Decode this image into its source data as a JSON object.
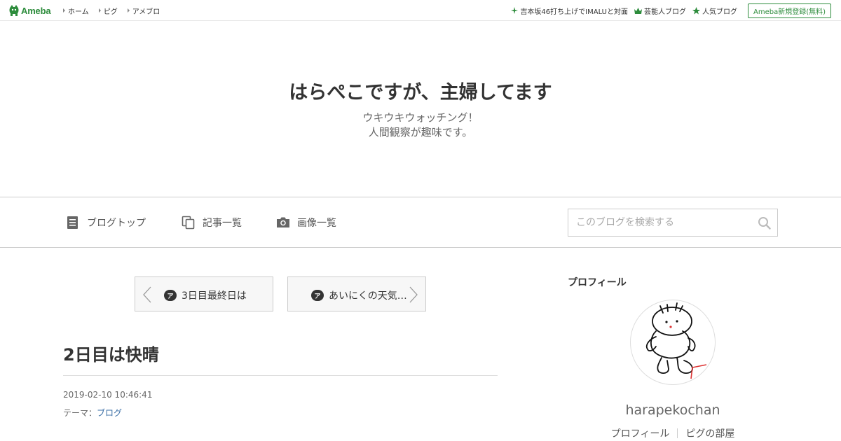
{
  "topbar": {
    "logo_text": "Ameba",
    "nav": [
      {
        "label": "ホーム"
      },
      {
        "label": "ピグ"
      },
      {
        "label": "アメブロ"
      }
    ],
    "right": [
      {
        "label": "吉本坂46打ち上げでIMALUと対面",
        "icon": "sparkle-icon"
      },
      {
        "label": "芸能人ブログ",
        "icon": "crown-icon"
      },
      {
        "label": "人気ブログ",
        "icon": "star-icon"
      }
    ],
    "signup_label": "Ameba新規登録(無料)",
    "accent": "#2d8c3c"
  },
  "header": {
    "title": "はらぺこですが、主婦してます",
    "desc_line1": "ウキウキウォッチング！",
    "desc_line2": "人間観察が趣味です。"
  },
  "subnav": {
    "items": [
      {
        "label": "ブログトップ",
        "icon": "document-icon"
      },
      {
        "label": "記事一覧",
        "icon": "copy-icon"
      },
      {
        "label": "画像一覧",
        "icon": "camera-icon"
      }
    ],
    "search_placeholder": "このブログを検索する"
  },
  "pager": {
    "prev_label": "3日目最終日は",
    "next_label": "あいにくの天気…",
    "badge": "ア"
  },
  "article": {
    "title": "2日目は快晴",
    "date": "2019-02-10 10:46:41",
    "theme_prefix": "テーマ：",
    "theme_link": "ブログ"
  },
  "sidebar": {
    "heading": "プロフィール",
    "username": "harapekochan",
    "links": [
      {
        "label": "プロフィール"
      },
      {
        "label": "ピグの部屋"
      }
    ]
  }
}
